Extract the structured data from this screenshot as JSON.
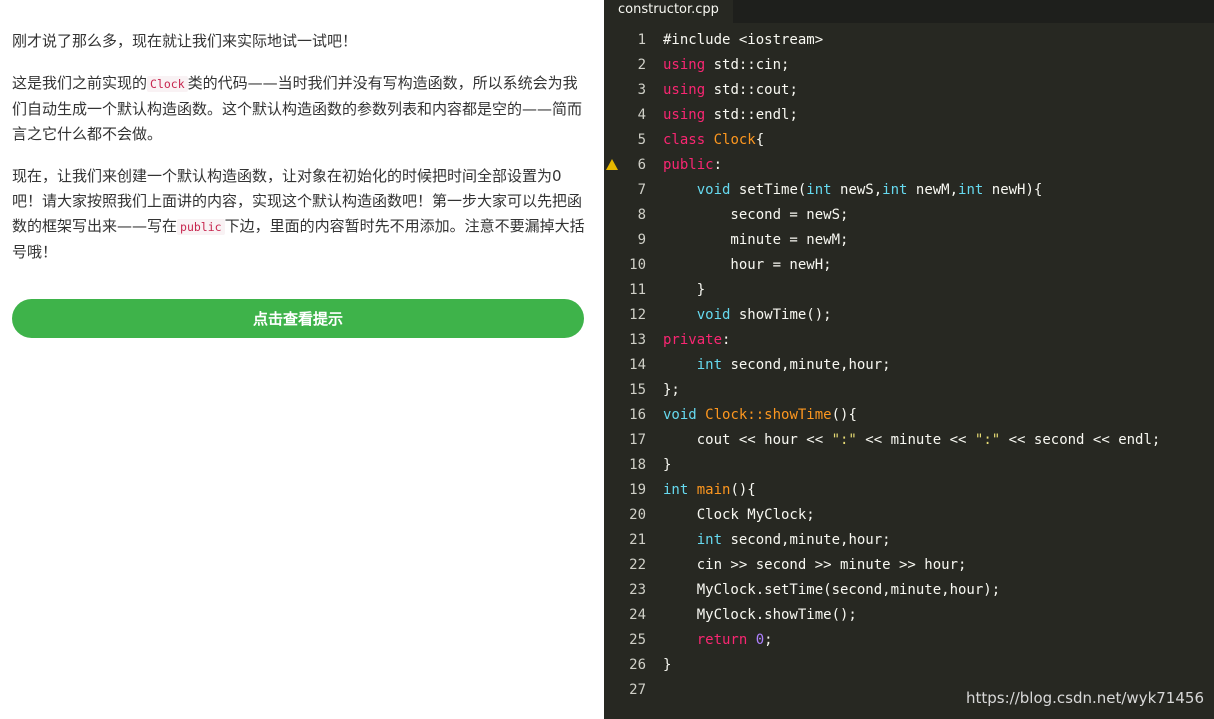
{
  "lesson": {
    "intro": "刚才说了那么多，现在就让我们来实际地试一试吧！",
    "para2_a": "这是我们之前实现的",
    "para2_code": "Clock",
    "para2_b": "类的代码——当时我们并没有写构造函数，所以系统会为我们自动生成一个默认构造函数。这个默认构造函数的参数列表和内容都是空的——简而言之它什么都不会做。",
    "para3_a": "现在，让我们来创建一个默认构造函数，让对象在初始化的时候把时间全部设置为0吧！请大家按照我们上面讲的内容，实现这个默认构造函数吧！第一步大家可以先把函数的框架写出来——写在",
    "para3_code": "public",
    "para3_b": "下边，里面的内容暂时先不用添加。注意不要漏掉大括号哦！",
    "hint_button": "点击查看提示"
  },
  "editor": {
    "tab_name": "constructor.cpp",
    "warning_line": 6,
    "lines": [
      [
        {
          "t": "#include <iostream>",
          "c": "pl"
        }
      ],
      [
        {
          "t": "using",
          "c": "kw"
        },
        {
          "t": " std::cin;",
          "c": "pl"
        }
      ],
      [
        {
          "t": "using",
          "c": "kw"
        },
        {
          "t": " std::cout;",
          "c": "pl"
        }
      ],
      [
        {
          "t": "using",
          "c": "kw"
        },
        {
          "t": " std::endl;",
          "c": "pl"
        }
      ],
      [
        {
          "t": "class",
          "c": "kw"
        },
        {
          "t": " ",
          "c": "pl"
        },
        {
          "t": "Clock",
          "c": "fn"
        },
        {
          "t": "{",
          "c": "pl"
        }
      ],
      [
        {
          "t": "public",
          "c": "kw"
        },
        {
          "t": ":",
          "c": "pl"
        }
      ],
      [
        {
          "t": "    ",
          "c": "pl"
        },
        {
          "t": "void",
          "c": "kt"
        },
        {
          "t": " setTime(",
          "c": "pl"
        },
        {
          "t": "int",
          "c": "kt"
        },
        {
          "t": " newS,",
          "c": "pl"
        },
        {
          "t": "int",
          "c": "kt"
        },
        {
          "t": " newM,",
          "c": "pl"
        },
        {
          "t": "int",
          "c": "kt"
        },
        {
          "t": " newH){",
          "c": "pl"
        }
      ],
      [
        {
          "t": "        second = newS;",
          "c": "pl"
        }
      ],
      [
        {
          "t": "        minute = newM;",
          "c": "pl"
        }
      ],
      [
        {
          "t": "        hour = newH;",
          "c": "pl"
        }
      ],
      [
        {
          "t": "    }",
          "c": "pl"
        }
      ],
      [
        {
          "t": "    ",
          "c": "pl"
        },
        {
          "t": "void",
          "c": "kt"
        },
        {
          "t": " showTime();",
          "c": "pl"
        }
      ],
      [
        {
          "t": "private",
          "c": "kw"
        },
        {
          "t": ":",
          "c": "pl"
        }
      ],
      [
        {
          "t": "    ",
          "c": "pl"
        },
        {
          "t": "int",
          "c": "kt"
        },
        {
          "t": " second,minute,hour;",
          "c": "pl"
        }
      ],
      [
        {
          "t": "};",
          "c": "pl"
        }
      ],
      [
        {
          "t": "void",
          "c": "kt"
        },
        {
          "t": " ",
          "c": "pl"
        },
        {
          "t": "Clock::showTime",
          "c": "fn"
        },
        {
          "t": "(){",
          "c": "pl"
        }
      ],
      [
        {
          "t": "    cout << hour << ",
          "c": "pl"
        },
        {
          "t": "\":\"",
          "c": "st"
        },
        {
          "t": " << minute << ",
          "c": "pl"
        },
        {
          "t": "\":\"",
          "c": "st"
        },
        {
          "t": " << second << endl;",
          "c": "pl"
        }
      ],
      [
        {
          "t": "}",
          "c": "pl"
        }
      ],
      [
        {
          "t": "int",
          "c": "kt"
        },
        {
          "t": " ",
          "c": "pl"
        },
        {
          "t": "main",
          "c": "fn"
        },
        {
          "t": "(){",
          "c": "pl"
        }
      ],
      [
        {
          "t": "    Clock MyClock;",
          "c": "pl"
        }
      ],
      [
        {
          "t": "    ",
          "c": "pl"
        },
        {
          "t": "int",
          "c": "kt"
        },
        {
          "t": " second,minute,hour;",
          "c": "pl"
        }
      ],
      [
        {
          "t": "    cin >> second >> minute >> hour;",
          "c": "pl"
        }
      ],
      [
        {
          "t": "    MyClock.setTime(second,minute,hour);",
          "c": "pl"
        }
      ],
      [
        {
          "t": "    MyClock.showTime();",
          "c": "pl"
        }
      ],
      [
        {
          "t": "    ",
          "c": "pl"
        },
        {
          "t": "return",
          "c": "kw"
        },
        {
          "t": " ",
          "c": "pl"
        },
        {
          "t": "0",
          "c": "nm"
        },
        {
          "t": ";",
          "c": "pl"
        }
      ],
      [
        {
          "t": "}",
          "c": "pl"
        }
      ],
      []
    ]
  },
  "watermark": "https://blog.csdn.net/wyk71456",
  "colors": {
    "editor_bg": "#272822",
    "keyword": "#f92672",
    "type": "#66d9ef",
    "function": "#fd971f",
    "string": "#e6db74",
    "number": "#ae81ff",
    "button": "#3eb34a"
  }
}
